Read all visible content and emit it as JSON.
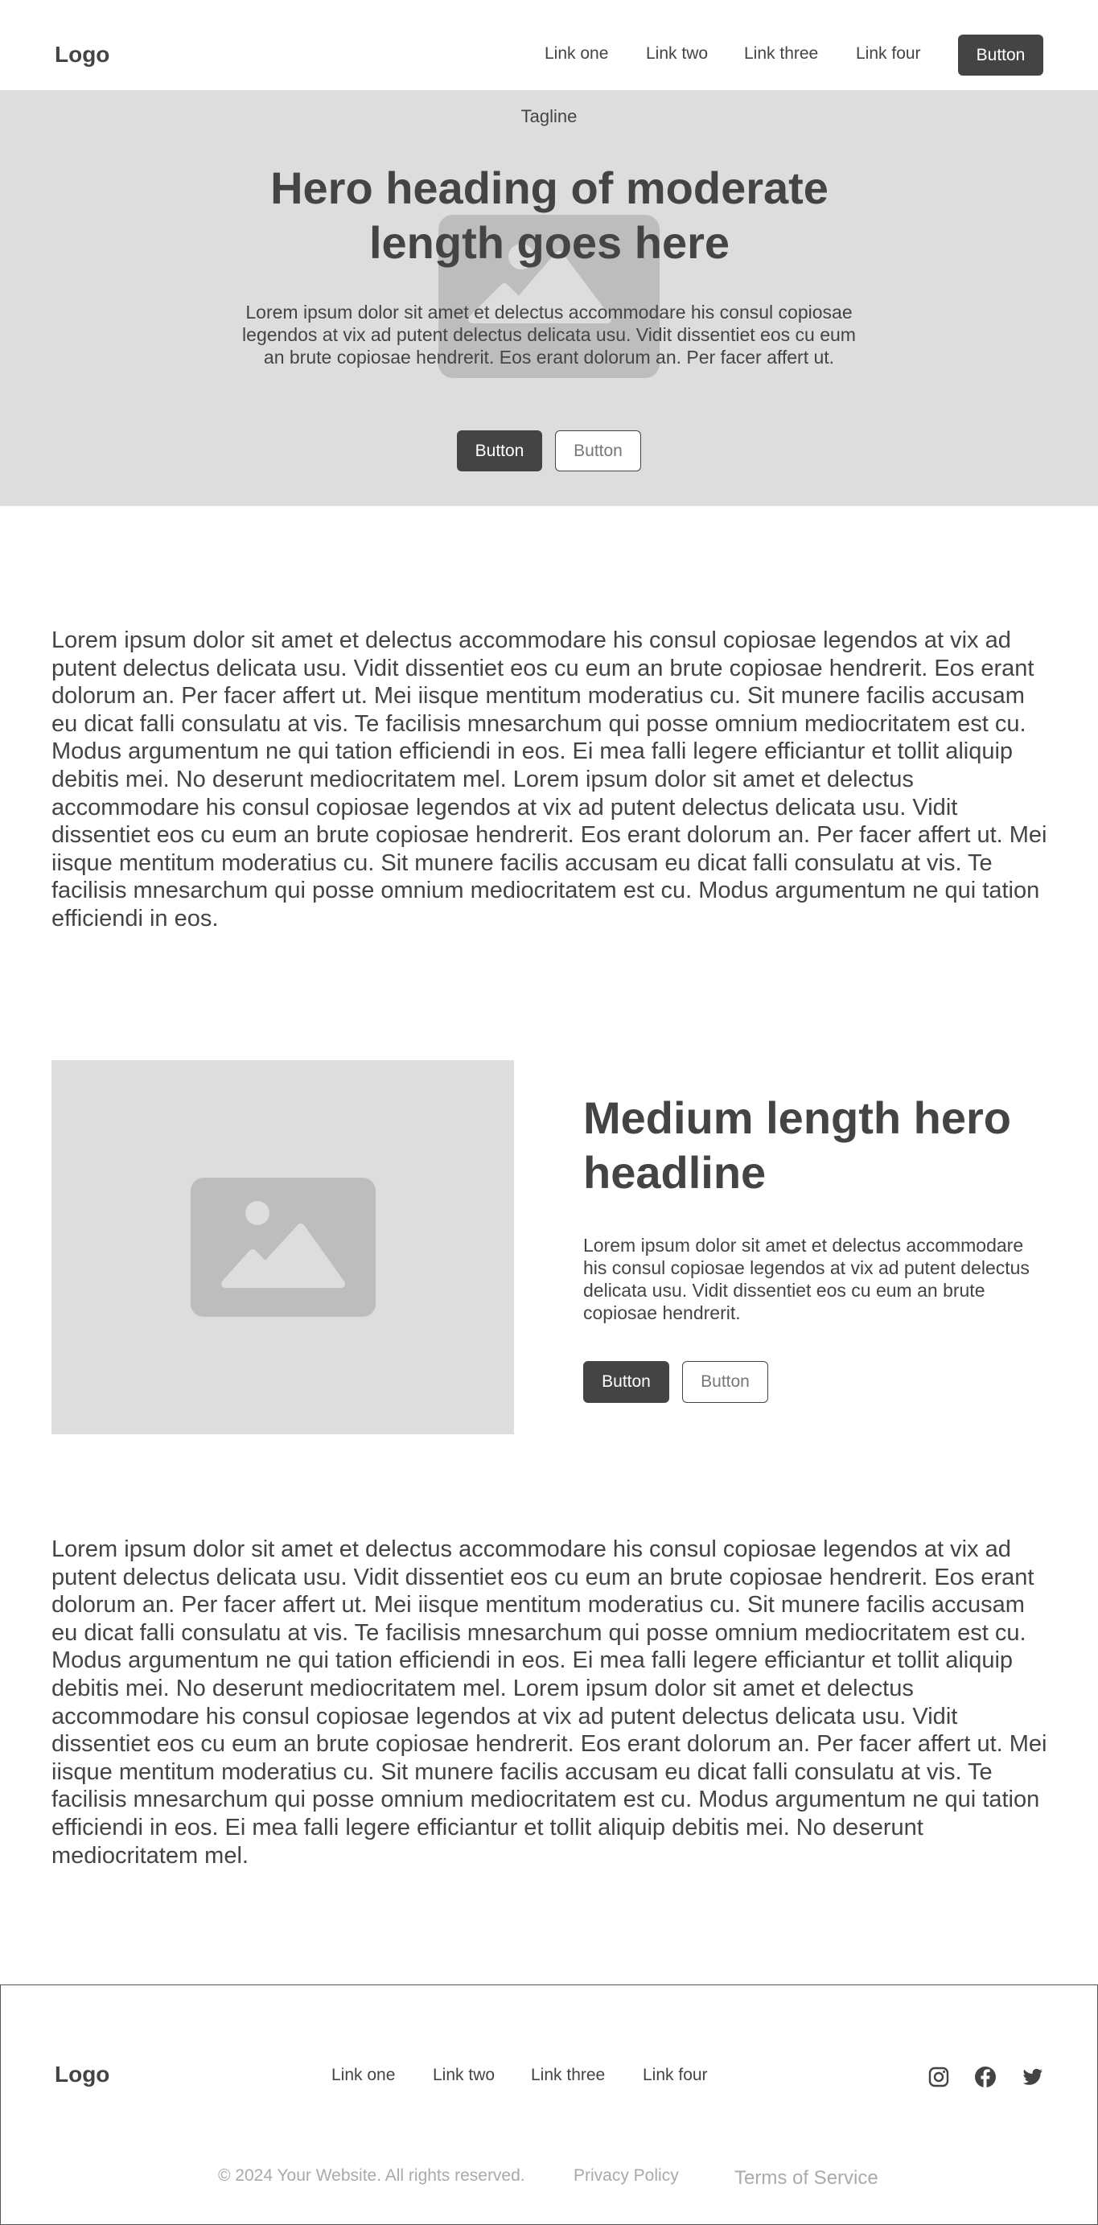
{
  "header": {
    "logo": "Logo",
    "nav": [
      "Link one",
      "Link two",
      "Link three",
      "Link four"
    ],
    "button": "Button"
  },
  "hero": {
    "tagline": "Tagline",
    "title": "Hero heading of moderate length goes here",
    "text": "Lorem ipsum dolor sit amet et delectus accommodare his consul copiosae legendos at vix ad putent delectus delicata usu. Vidit dissentiet eos cu eum an brute copiosae hendrerit. Eos erant dolorum an. Per facer affert ut.",
    "primary_button": "Button",
    "secondary_button": "Button",
    "image_icon": "image-placeholder-icon"
  },
  "body1": {
    "text": "Lorem ipsum dolor sit amet et delectus accommodare his consul copiosae legendos at vix ad putent delectus delicata usu. Vidit dissentiet eos cu eum an brute copiosae hendrerit. Eos erant dolorum an. Per facer affert ut. Mei iisque mentitum moderatius cu. Sit munere facilis accusam eu dicat falli consulatu at vis. Te facilisis mnesarchum qui posse omnium mediocritatem est cu. Modus argumentum ne qui tation efficiendi in eos. Ei mea falli legere efficiantur et tollit aliquip debitis mei. No deserunt mediocritatem mel. Lorem ipsum dolor sit amet et delectus accommodare his consul copiosae legendos at vix ad putent delectus delicata usu. Vidit dissentiet eos cu eum an brute copiosae hendrerit. Eos erant dolorum an. Per facer affert ut. Mei iisque mentitum moderatius cu. Sit munere facilis accusam eu dicat falli consulatu at vis. Te facilisis mnesarchum qui posse omnium mediocritatem est cu. Modus argumentum ne qui tation efficiendi in eos."
  },
  "feature": {
    "title": "Medium length hero headline",
    "text": "Lorem ipsum dolor sit amet et delectus accommodare his consul copiosae legendos at vix ad putent delectus delicata usu. Vidit dissentiet eos cu eum an brute copiosae hendrerit.",
    "primary_button": "Button",
    "secondary_button": "Button",
    "image_icon": "image-placeholder-icon"
  },
  "body2": {
    "text": "Lorem ipsum dolor sit amet et delectus accommodare his consul copiosae legendos at vix ad putent delectus delicata usu. Vidit dissentiet eos cu eum an brute copiosae hendrerit. Eos erant dolorum an. Per facer affert ut. Mei iisque mentitum moderatius cu. Sit munere facilis accusam eu dicat falli consulatu at vis. Te facilisis mnesarchum qui posse omnium mediocritatem est cu. Modus argumentum ne qui tation efficiendi in eos. Ei mea falli legere efficiantur et tollit aliquip debitis mei. No deserunt mediocritatem mel. Lorem ipsum dolor sit amet et delectus accommodare his consul copiosae legendos at vix ad putent delectus delicata usu. Vidit dissentiet eos cu eum an brute copiosae hendrerit. Eos erant dolorum an. Per facer affert ut. Mei iisque mentitum moderatius cu. Sit munere facilis accusam eu dicat falli consulatu at vis. Te facilisis mnesarchum qui posse omnium mediocritatem est cu. Modus argumentum ne qui tation efficiendi in eos. Ei mea falli legere efficiantur et tollit aliquip debitis mei. No deserunt mediocritatem mel."
  },
  "footer": {
    "logo": "Logo",
    "nav": [
      "Link one",
      "Link two",
      "Link three",
      "Link four"
    ],
    "social_icons": [
      "instagram-icon",
      "facebook-icon",
      "twitter-icon"
    ],
    "copyright": "© 2024 Your Website. All rights reserved.",
    "privacy": "Privacy Policy",
    "terms": "Terms of Service"
  },
  "colors": {
    "text": "#444444",
    "panel": "#dddddd",
    "placeholder": "#bdbdbd",
    "button_dark": "#444444",
    "muted": "#aaaaaa"
  }
}
